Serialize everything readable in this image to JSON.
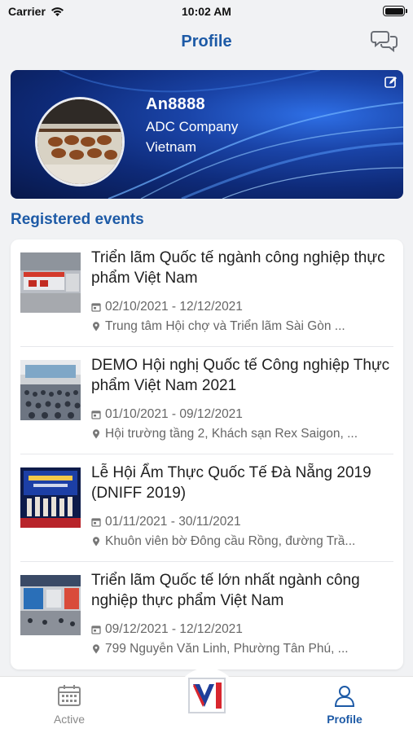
{
  "status_bar": {
    "carrier": "Carrier",
    "time": "10:02 AM"
  },
  "nav": {
    "title": "Profile",
    "right_icon": "chat-bubbles-icon"
  },
  "profile": {
    "name": "An8888",
    "company": "ADC Company",
    "country": "Vietnam",
    "edit_icon": "edit-icon"
  },
  "section": {
    "title": "Registered events"
  },
  "events": [
    {
      "title": "Triển lãm Quốc tế ngành công nghiệp thực phẩm Việt Nam",
      "date": "02/10/2021 - 12/12/2021",
      "location": "Trung tâm Hội chợ và Triển lãm Sài Gòn ..."
    },
    {
      "title": "DEMO Hội nghị Quốc tế Công nghiệp Thực phẩm Việt Nam 2021",
      "date": "01/10/2021 - 09/12/2021",
      "location": "Hội trường tầng 2, Khách sạn Rex Saigon, ..."
    },
    {
      "title": "Lễ Hội Ẩm Thực Quốc Tế Đà Nẵng 2019 (DNIFF 2019)",
      "date": "01/11/2021 - 30/11/2021",
      "location": "Khuôn viên bờ Đông cầu Rồng, đường Trầ..."
    },
    {
      "title": "Triển lãm Quốc tế lớn nhất ngành công nghiệp thực phẩm Việt Nam",
      "date": "09/12/2021 - 12/12/2021",
      "location": "799 Nguyễn Văn Linh, Phường Tân Phú, ..."
    }
  ],
  "tab_bar": {
    "tabs": [
      {
        "label": "Active",
        "icon": "calendar-icon",
        "selected": false
      },
      {
        "label": "Profile",
        "icon": "person-icon",
        "selected": true
      }
    ],
    "center_logo": "VIETRADE"
  },
  "colors": {
    "accent": "#1d5aa6",
    "background": "#f1f2f4"
  }
}
